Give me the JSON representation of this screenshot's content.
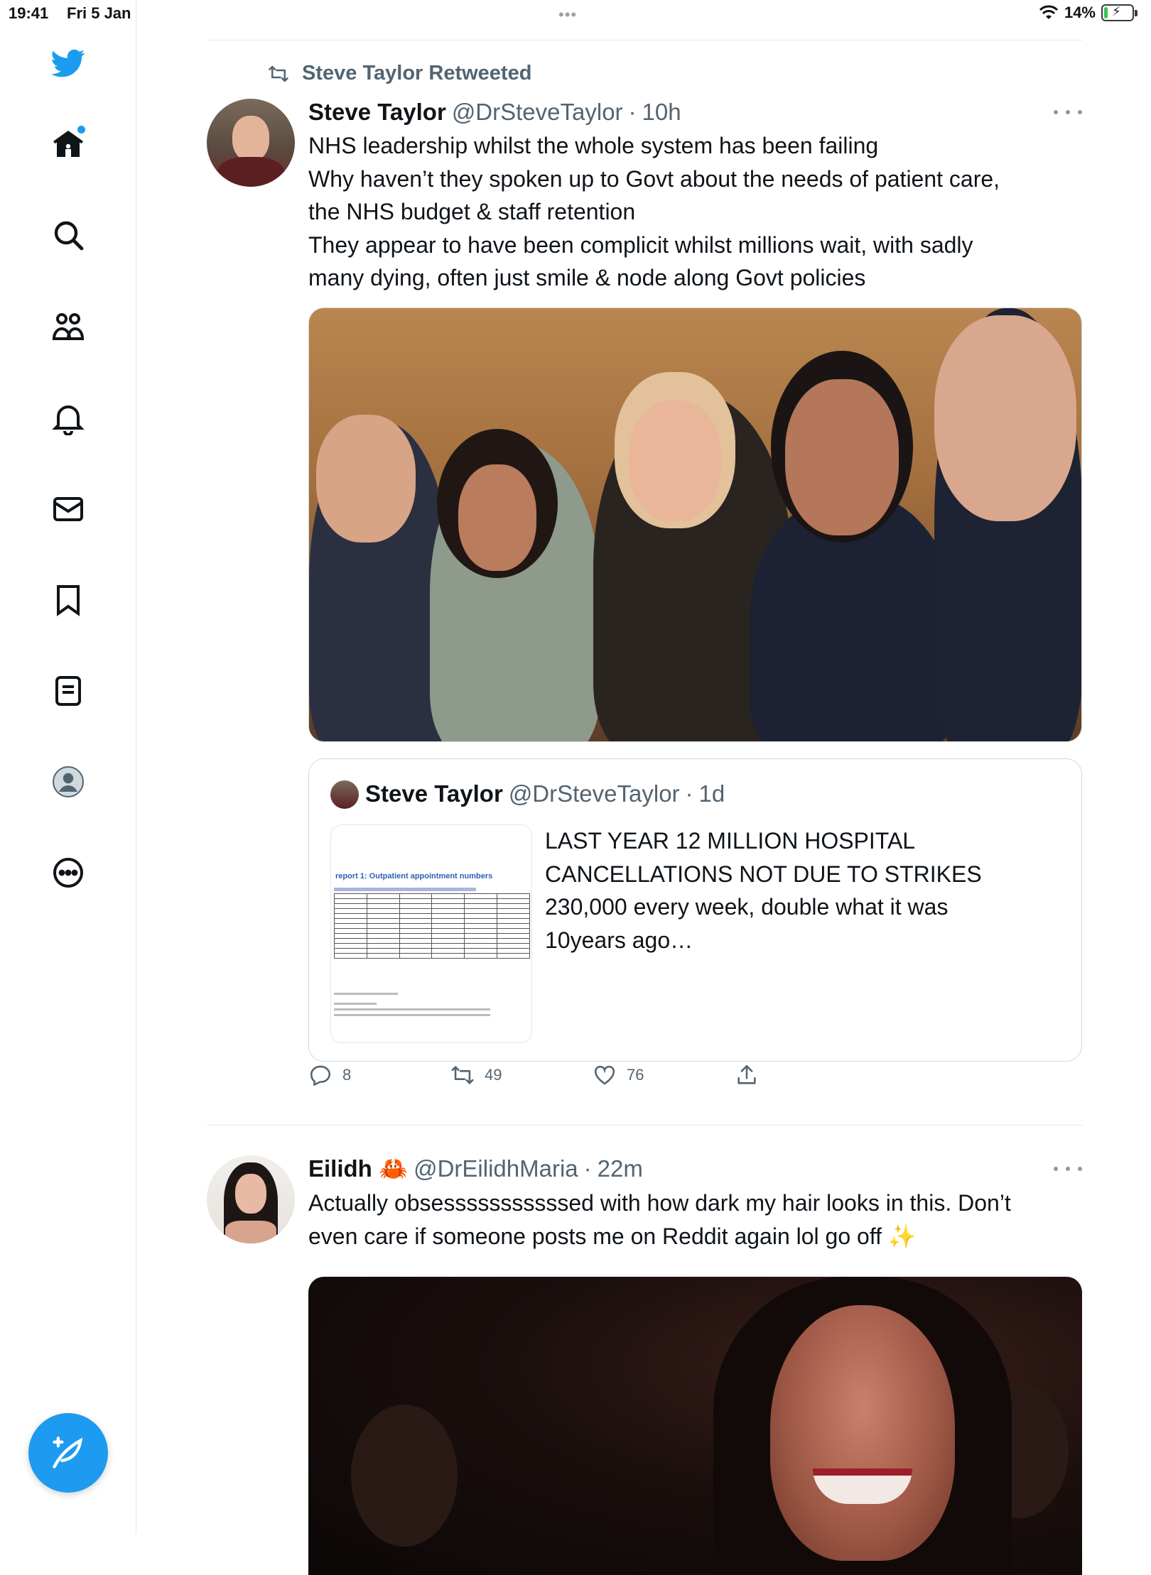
{
  "status_bar": {
    "time": "19:41",
    "date": "Fri 5 Jan",
    "battery": "14%",
    "battery_level": 0.14
  },
  "sidebar": {
    "items": [
      {
        "icon": "twitter-bird-icon"
      },
      {
        "icon": "home-icon",
        "has_notification": true
      },
      {
        "icon": "search-icon"
      },
      {
        "icon": "communities-icon"
      },
      {
        "icon": "notifications-bell-icon"
      },
      {
        "icon": "messages-envelope-icon"
      },
      {
        "icon": "bookmark-icon"
      },
      {
        "icon": "lists-icon"
      },
      {
        "icon": "profile-avatar-icon"
      },
      {
        "icon": "more-options-icon"
      }
    ],
    "compose_icon": "compose-feather-icon",
    "accent_color": "#1d9bf0"
  },
  "tweets": [
    {
      "retweeted_by": "Steve Taylor Retweeted",
      "name": "Steve Taylor",
      "handle": "@DrSteveTaylor",
      "separator": "·",
      "time": "10h",
      "text_lines": [
        "NHS leadership whilst the whole system has been failing",
        "Why haven’t they spoken up to Govt about the needs of patient care,",
        "the NHS budget & staff retention",
        "They appear to have been complicit whilst millions wait, with sadly",
        "many dying, often just smile & node along Govt policies"
      ],
      "quote": {
        "name": "Steve Taylor",
        "handle": "@DrSteveTaylor",
        "separator": "·",
        "time": "1d",
        "thumbnail_title": "report 1: Outpatient appointment numbers",
        "text_lines": [
          "LAST YEAR 12 MILLION HOSPITAL",
          "CANCELLATIONS NOT DUE TO STRIKES",
          "230,000 every week, double what it was",
          "10years ago…"
        ]
      },
      "actions": {
        "replies": "8",
        "retweets": "49",
        "likes": "76"
      }
    },
    {
      "name": "Eilidh 🦀",
      "handle": "@DrEilidhMaria",
      "separator": "·",
      "time": "22m",
      "text_lines": [
        "Actually obsesssssssssssed with how dark my hair looks in this. Don’t",
        "even care if someone posts me on Reddit again lol go off ✨"
      ]
    }
  ]
}
